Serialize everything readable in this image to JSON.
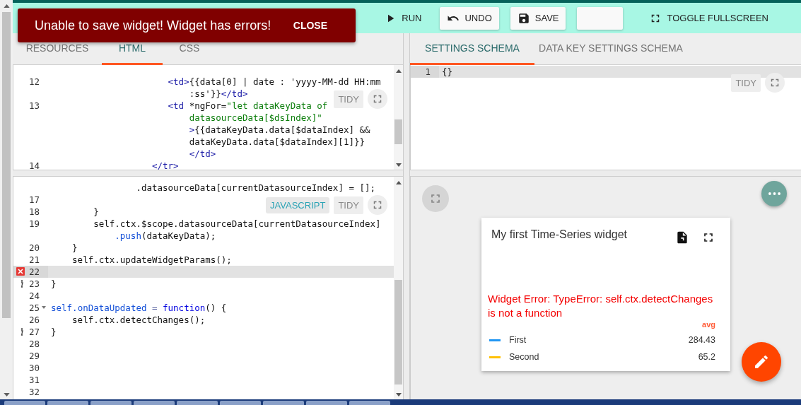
{
  "toast": {
    "message": "Unable to save widget! Widget has errors!",
    "action": "CLOSE"
  },
  "toolbar": [
    {
      "kind": "run",
      "label": "RUN"
    },
    {
      "kind": "undo",
      "label": "UNDO"
    },
    {
      "kind": "save",
      "label": "SAVE"
    },
    {
      "kind": "blank"
    },
    {
      "kind": "fullscreen",
      "label": "TOGGLE FULLSCREEN"
    }
  ],
  "left_tabs": [
    {
      "label": "RESOURCES",
      "selected": false
    },
    {
      "label": "HTML",
      "selected": true
    },
    {
      "label": "CSS",
      "selected": false
    }
  ],
  "html_editor": {
    "tidy": "TIDY",
    "lines": [
      {
        "number": "12",
        "active": false,
        "rows": [
          {
            "spans": [
              {
                "kind": "tag",
                "text": "                      <td>"
              },
              {
                "kind": "plain",
                "text": "{{data[0] | date : 'yyyy-MM-dd HH:mm"
              }
            ]
          },
          {
            "spans": [
              {
                "kind": "plain",
                "text": "                          :ss'}}"
              },
              {
                "kind": "tag",
                "text": "</td>"
              }
            ]
          }
        ]
      },
      {
        "number": "13",
        "active": false,
        "rows": [
          {
            "spans": [
              {
                "kind": "tag",
                "text": "                      <td"
              },
              {
                "kind": "plain",
                "text": " *ngFor="
              },
              {
                "kind": "string",
                "text": "\"let dataKeyData of"
              }
            ]
          },
          {
            "spans": [
              {
                "kind": "string",
                "text": "                          datasourceData[$dsIndex]\""
              }
            ]
          },
          {
            "spans": [
              {
                "kind": "tag",
                "text": "                          >"
              },
              {
                "kind": "plain",
                "text": "{{dataKeyData.data[$dataIndex] &&"
              }
            ]
          },
          {
            "spans": [
              {
                "kind": "plain",
                "text": "                          dataKeyData.data[$dataIndex][1]}}"
              }
            ]
          },
          {
            "spans": [
              {
                "kind": "tag",
                "text": "                          </td>"
              }
            ]
          }
        ]
      },
      {
        "number": "14",
        "active": false,
        "rows": [
          {
            "spans": [
              {
                "kind": "tag",
                "text": "                   </tr>"
              }
            ]
          }
        ]
      }
    ]
  },
  "js_editor": {
    "language": "JAVASCRIPT",
    "tidy": "TIDY",
    "lines": [
      {
        "kind": "plain",
        "active": false,
        "foldable": false,
        "rows": [
          {
            "spans": [
              {
                "kind": "plain",
                "text": "                .datasourceData[currentDatasourceIndex] = [];"
              }
            ]
          }
        ]
      },
      {
        "kind": "plain",
        "number": "17",
        "active": false,
        "foldable": false
      },
      {
        "kind": "plain",
        "number": "18",
        "active": false,
        "foldable": false,
        "rows": [
          {
            "spans": [
              {
                "kind": "plain",
                "text": "        }"
              }
            ]
          }
        ]
      },
      {
        "kind": "plain",
        "number": "19",
        "active": false,
        "foldable": false,
        "rows": [
          {
            "spans": [
              {
                "kind": "plain",
                "text": "        self.ctx.$scope.datasourceData[currentDatasourceIndex]"
              }
            ]
          },
          {
            "spans": [
              {
                "kind": "property",
                "text": "            .push"
              },
              {
                "kind": "plain",
                "text": "(dataKeyData);"
              }
            ]
          }
        ]
      },
      {
        "kind": "plain",
        "number": "20",
        "active": false,
        "foldable": false,
        "rows": [
          {
            "spans": [
              {
                "kind": "plain",
                "text": "    }"
              }
            ]
          }
        ]
      },
      {
        "kind": "plain",
        "number": "21",
        "active": false,
        "foldable": false,
        "rows": [
          {
            "spans": [
              {
                "kind": "plain",
                "text": "    self.ctx.updateWidgetParams();"
              }
            ]
          }
        ]
      },
      {
        "kind": "error",
        "number": "22",
        "active": true,
        "foldable": false
      },
      {
        "kind": "info",
        "number": "23",
        "active": false,
        "foldable": false,
        "rows": [
          {
            "spans": [
              {
                "kind": "plain",
                "text": "}"
              }
            ]
          }
        ]
      },
      {
        "kind": "plain",
        "number": "24",
        "active": false,
        "foldable": false
      },
      {
        "kind": "plain",
        "number": "25",
        "active": false,
        "foldable": true,
        "rows": [
          {
            "spans": [
              {
                "kind": "def",
                "text": "self"
              },
              {
                "kind": "property",
                "text": ".onDataUpdated"
              },
              {
                "kind": "operator",
                "text": " = "
              },
              {
                "kind": "keyword",
                "text": "function"
              },
              {
                "kind": "plain",
                "text": "() {"
              }
            ]
          }
        ]
      },
      {
        "kind": "plain",
        "number": "26",
        "active": false,
        "foldable": false,
        "rows": [
          {
            "spans": [
              {
                "kind": "plain",
                "text": "    self.ctx.detectChanges();"
              }
            ]
          }
        ]
      },
      {
        "kind": "info",
        "number": "27",
        "active": false,
        "foldable": false,
        "rows": [
          {
            "spans": [
              {
                "kind": "plain",
                "text": "}"
              }
            ]
          }
        ]
      },
      {
        "kind": "plain",
        "number": "28",
        "active": false,
        "foldable": false
      },
      {
        "kind": "plain",
        "number": "29",
        "active": false,
        "foldable": false
      },
      {
        "kind": "plain",
        "number": "30",
        "active": false,
        "foldable": false
      },
      {
        "kind": "plain",
        "number": "31",
        "active": false,
        "foldable": false
      },
      {
        "kind": "plain",
        "number": "32",
        "active": false,
        "foldable": false
      }
    ]
  },
  "right_tabs": [
    {
      "label": "SETTINGS SCHEMA",
      "selected": true
    },
    {
      "label": "DATA KEY SETTINGS SCHEMA",
      "selected": false
    }
  ],
  "settings_editor": {
    "tidy": "TIDY",
    "lines": [
      {
        "number": "1",
        "active": true,
        "rows": [
          {
            "spans": [
              {
                "kind": "plain",
                "text": "{}"
              }
            ]
          }
        ]
      }
    ]
  },
  "preview": {
    "widget": {
      "title": "My first Time-Series widget",
      "error": "Widget Error: TypeError: self.ctx.detectChanges is not a function",
      "legend_header": "avg",
      "legend": [
        {
          "label": "First",
          "value": "284.43",
          "color": "#2196f3"
        },
        {
          "label": "Second",
          "value": "65.2",
          "color": "#ffc107"
        }
      ]
    }
  }
}
